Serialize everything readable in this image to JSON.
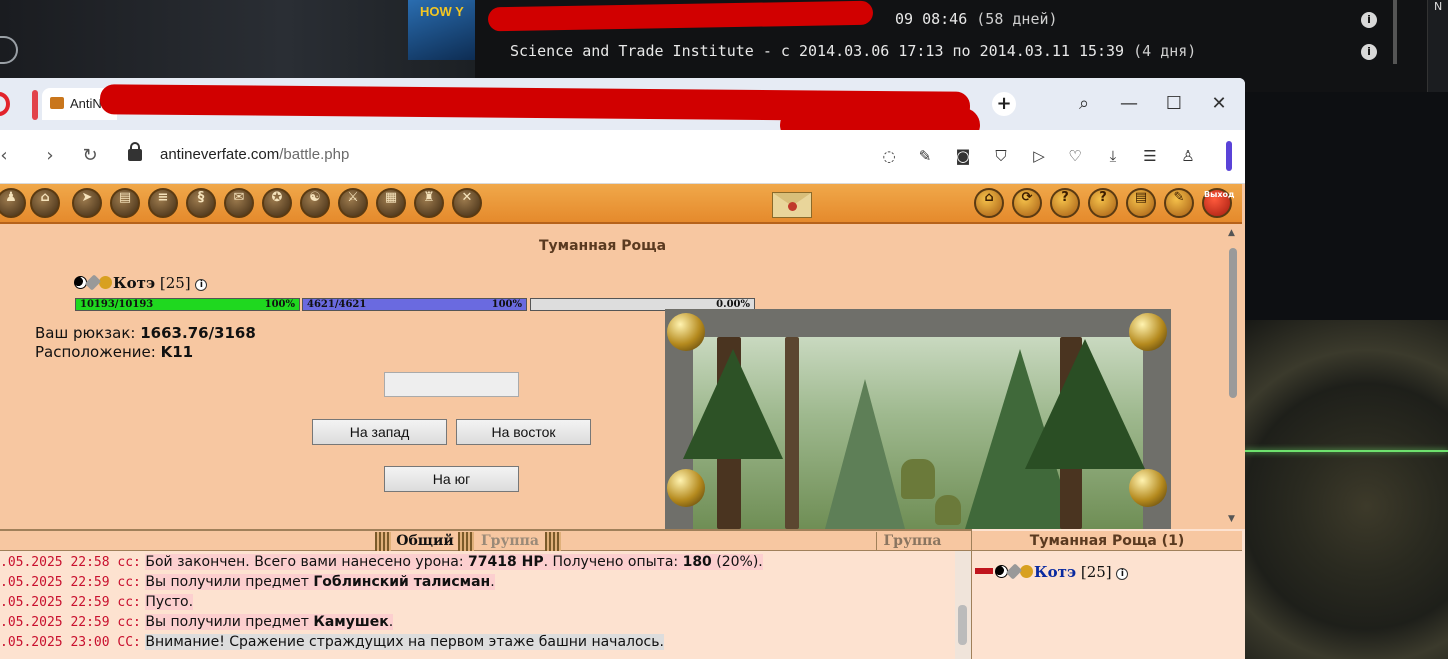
{
  "background": {
    "thumb_text": "HOW Y",
    "line1_date": "09 08:46",
    "line1_days": "(58 дней)",
    "line2": "Science and Trade Institute - с 2014.03.06 17:13 по 2014.03.11 15:39",
    "line2_days": "(4 дня)",
    "info": "i",
    "right_text": "N"
  },
  "browser": {
    "tab_title": "AntiN",
    "url_host": "antineverfate.com",
    "url_path": "/battle.php",
    "add_tab": "+",
    "minimize": "—",
    "maximize": "☐",
    "close": "✕"
  },
  "game": {
    "location_title": "Туманная Роща",
    "character": {
      "name": "Котэ",
      "level": "[25]"
    },
    "hp": {
      "text": "10193/10193",
      "percent_text": "100%",
      "fill": 1.0,
      "color": "#1fd81f"
    },
    "mana": {
      "text": "4621/4621",
      "percent_text": "100%",
      "fill": 1.0,
      "color": "#6a6ae0"
    },
    "exp": {
      "percent_text": "0.00%",
      "fill": 0.0
    },
    "backpack_label": "Ваш рюкзак:",
    "backpack_value": "1663.76/3168",
    "location_label": "Расположение:",
    "location_value": "K11",
    "btn_west": "На запад",
    "btn_east": "На восток",
    "btn_south": "На юг",
    "exit_label": "Выход"
  },
  "chat": {
    "tab_general": "Общий",
    "tab_group": "Группа",
    "tab_group_right": "Группа",
    "messages": [
      {
        "time": ".05.2025 22:58",
        "cc": "cc:",
        "parts": [
          "Бой закончен. Всего вами нанесено урона: ",
          "77418 HP",
          ". Получено опыта: ",
          "180",
          " (20%)."
        ]
      },
      {
        "time": ".05.2025 22:59",
        "cc": "cc:",
        "parts": [
          "Вы получили предмет ",
          "Гоблинский талисман",
          "."
        ]
      },
      {
        "time": ".05.2025 22:59",
        "cc": "cc:",
        "parts": [
          "Пусто."
        ]
      },
      {
        "time": ".05.2025 22:59",
        "cc": "cc:",
        "parts": [
          "Вы получили предмет ",
          "Камушек",
          "."
        ]
      },
      {
        "time": ".05.2025 23:00",
        "cc": "CC:",
        "parts": [
          "Внимание! Сражение страждущих на первом этаже башни началось."
        ]
      }
    ]
  },
  "online": {
    "title": "Туманная Роща (1)",
    "user_name": "Котэ",
    "user_level": "[25]"
  }
}
